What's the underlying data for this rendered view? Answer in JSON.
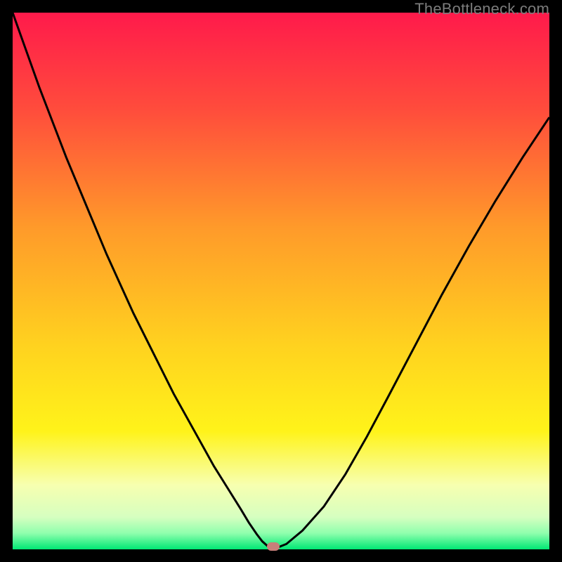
{
  "watermark": "TheBottleneck.com",
  "chart_data": {
    "type": "line",
    "title": "",
    "xlabel": "",
    "ylabel": "",
    "xlim": [
      0,
      100
    ],
    "ylim": [
      0,
      100
    ],
    "grid": false,
    "background_gradient": {
      "stops": [
        {
          "pos": 0.0,
          "color": "#ff1a4b"
        },
        {
          "pos": 0.18,
          "color": "#ff4c3c"
        },
        {
          "pos": 0.4,
          "color": "#ff9a2a"
        },
        {
          "pos": 0.62,
          "color": "#ffd21f"
        },
        {
          "pos": 0.78,
          "color": "#fff31a"
        },
        {
          "pos": 0.88,
          "color": "#f7ffb0"
        },
        {
          "pos": 0.94,
          "color": "#d6ffc0"
        },
        {
          "pos": 0.97,
          "color": "#8fffad"
        },
        {
          "pos": 1.0,
          "color": "#00e874"
        }
      ]
    },
    "series": [
      {
        "name": "bottleneck-curve",
        "color": "#000000",
        "x": [
          0.0,
          2.5,
          5.0,
          7.5,
          10.0,
          12.5,
          15.0,
          17.5,
          20.0,
          22.5,
          25.0,
          27.5,
          30.0,
          32.5,
          35.0,
          37.5,
          40.0,
          42.5,
          44.0,
          45.5,
          46.5,
          47.5,
          49.0,
          51.0,
          54.0,
          58.0,
          62.0,
          66.0,
          70.0,
          75.0,
          80.0,
          85.0,
          90.0,
          95.0,
          100.0
        ],
        "y": [
          100.0,
          93.0,
          86.0,
          79.5,
          73.0,
          67.0,
          61.0,
          55.0,
          49.5,
          44.0,
          39.0,
          34.0,
          29.0,
          24.5,
          20.0,
          15.5,
          11.5,
          7.5,
          5.0,
          2.8,
          1.5,
          0.6,
          0.2,
          1.0,
          3.5,
          8.0,
          14.0,
          21.0,
          28.5,
          38.0,
          47.5,
          56.5,
          65.0,
          73.0,
          80.5
        ]
      }
    ],
    "marker": {
      "x": 48.5,
      "y": 0.5,
      "color": "#c87f7a"
    },
    "legend": false
  }
}
